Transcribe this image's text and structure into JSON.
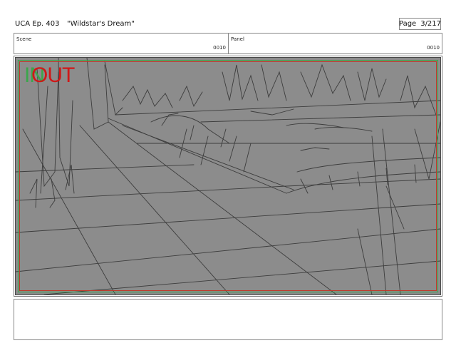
{
  "header": {
    "show": "UCA Ep. 403",
    "episode_title": "\"Wildstar's Dream\"",
    "page_label": "Page",
    "page_number": "3/217"
  },
  "info": {
    "scene_label": "Scene",
    "scene_value": "0010",
    "panel_label": "Panel",
    "panel_value": "0010"
  },
  "panel": {
    "transition_in": "IN",
    "transition_out": "OUT",
    "colors": {
      "in": "#3aa64a",
      "out": "#d01818",
      "drawing_bg": "#8c8c8c",
      "sketch_line": "#3d3d3d"
    }
  },
  "notes": {
    "text": ""
  }
}
